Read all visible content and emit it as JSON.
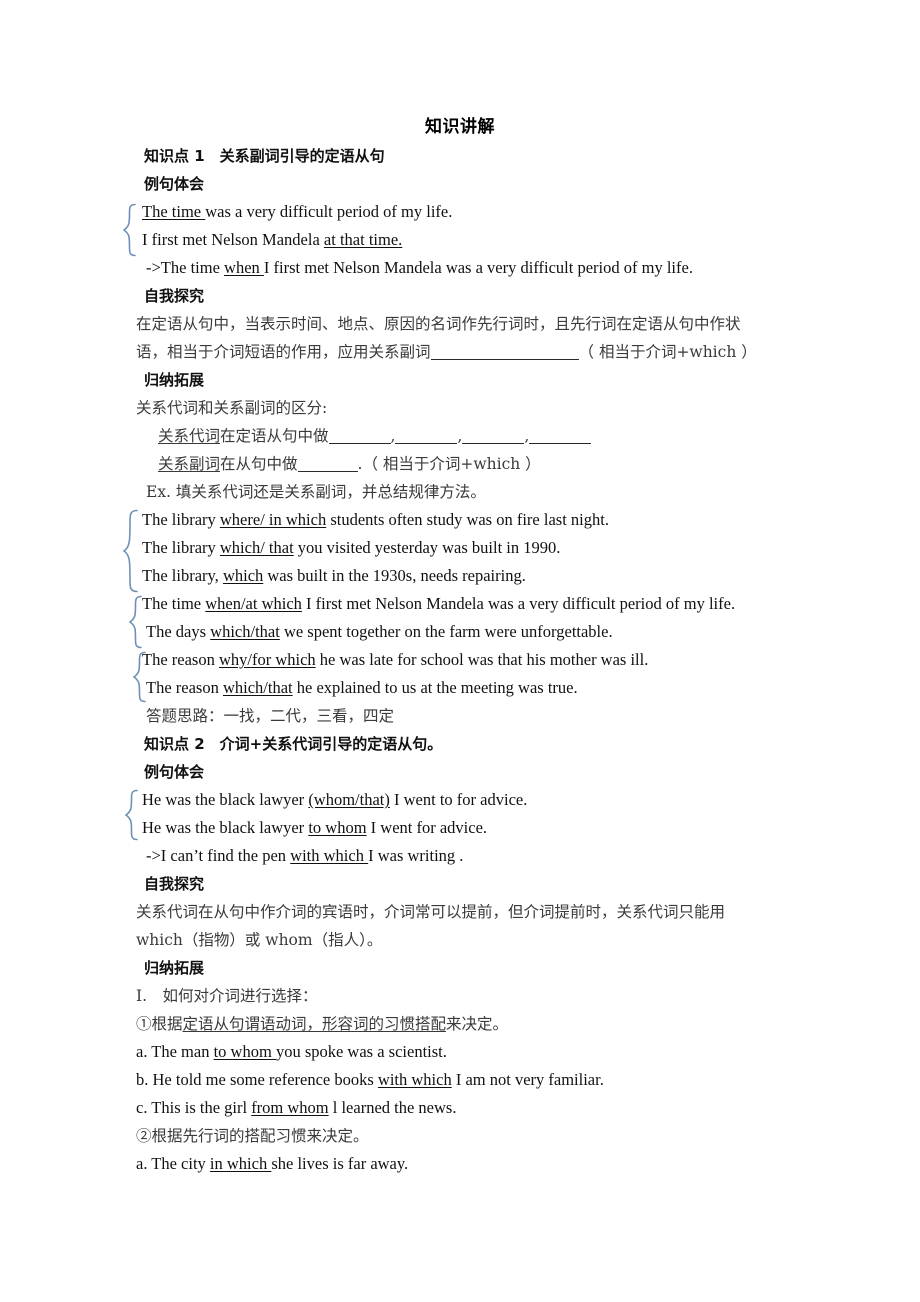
{
  "document": {
    "title": "知识讲解",
    "sections": [
      {
        "id": "point1",
        "heading": "知识点 1　关系副词引导的定语从句",
        "sub1_label": "例句体会",
        "examples": [
          {
            "pre": "",
            "u1": "The time ",
            "mid": "was a very difficult period of my life.",
            "u2": "",
            "post": ""
          },
          {
            "pre": "I first met Nelson Mandela ",
            "u1": "at that time.",
            "mid": "",
            "u2": "",
            "post": ""
          }
        ],
        "arrow_line_pre": "->The time ",
        "arrow_line_u": "when ",
        "arrow_line_post": "I first met Nelson Mandela was a very difficult period of my life.",
        "sub2_label": "自我探究",
        "explore_line1": "在定语从句中，当表示时间、地点、原因的名词作先行词时，且先行词在定语从句中作状",
        "explore_line2_a": "语，相当于介词短语的作用，应用关系副词",
        "explore_line2_b": "（ 相当于介词+which ）",
        "sub3_label": "归纳拓展",
        "distinguish_label": "关系代词和关系副词的区分:",
        "rule1_u": "关系代词",
        "rule1_text": "在定语从句中做",
        "rule1_seps": [
          ",",
          ",",
          ",",
          ""
        ],
        "rule2_u": "关系副词",
        "rule2_text": "在从句中做",
        "rule2_tail": ".（ 相当于介词+which ）",
        "ex_label": "Ex. 填关系代词还是关系副词，并总结规律方法。",
        "practice": [
          {
            "pre": "The library ",
            "u": "where/ in which",
            "post": " students often study was on fire last night."
          },
          {
            "pre": "The library ",
            "u": "which/ that",
            "post": " you visited yesterday was built in 1990."
          },
          {
            "pre": "The library, ",
            "u": "which",
            "post": " was built in the 1930s, needs repairing."
          },
          {
            "pre": "The time ",
            "u": "when/at which",
            "post": " I first met Nelson Mandela was a very difficult period of my life."
          },
          {
            "pre": "The days ",
            "u": "which/that",
            "post": " we spent together on the farm were unforgettable."
          },
          {
            "pre": "The reason ",
            "u": "why/for which",
            "post": " he was late for school was that his mother was ill."
          },
          {
            "pre": "The reason ",
            "u": "which/that",
            "post": " he explained to us at the meeting was true."
          }
        ],
        "strategy_line": "答题思路：一找，二代，三看，四定"
      },
      {
        "id": "point2",
        "heading": "知识点 2　介词+关系代词引导的定语从句。",
        "sub1_label": "例句体会",
        "examples": [
          {
            "pre": "He was the black lawyer ",
            "u": "(whom/that)",
            "post": " I went to for advice."
          },
          {
            "pre": "He was the black lawyer ",
            "u": "to whom",
            "post": " I went for advice."
          }
        ],
        "arrow_line_pre": "->I can’t find the pen ",
        "arrow_line_u": "with which ",
        "arrow_line_post": "I was writing .",
        "sub2_label": "自我探究",
        "explore_line1": "关系代词在从句中作介词的宾语时，介词常可以提前，但介词提前时，关系代词只能用",
        "explore_line2": "which（指物）或 whom（指人）。",
        "sub3_label": "归纳拓展",
        "roman_item": "Ⅰ.　如何对介词进行选择：",
        "item1_pre": "①根据",
        "item1_u": "定语从句谓语动词，形容词的习惯搭配",
        "item1_post": "来决定。",
        "item1_examples": [
          {
            "pre": "a. The man ",
            "u": "to whom ",
            "post": "you spoke was a scientist."
          },
          {
            "pre": "b. He told me some reference books ",
            "u": "with which",
            "post": " I am not very familiar."
          },
          {
            "pre": "c. This is the girl ",
            "u": "from whom",
            "post": " l learned the news."
          }
        ],
        "item2": "②根据先行词的搭配习惯来决定。",
        "item2_examples": [
          {
            "pre": "a. The city ",
            "u": "in which ",
            "post": "she lives is far away."
          }
        ]
      }
    ]
  },
  "style": {
    "brace_color": "#6f91b8",
    "text_color": "#1f1f1f",
    "heading_color": "#111111",
    "background": "#ffffff"
  }
}
